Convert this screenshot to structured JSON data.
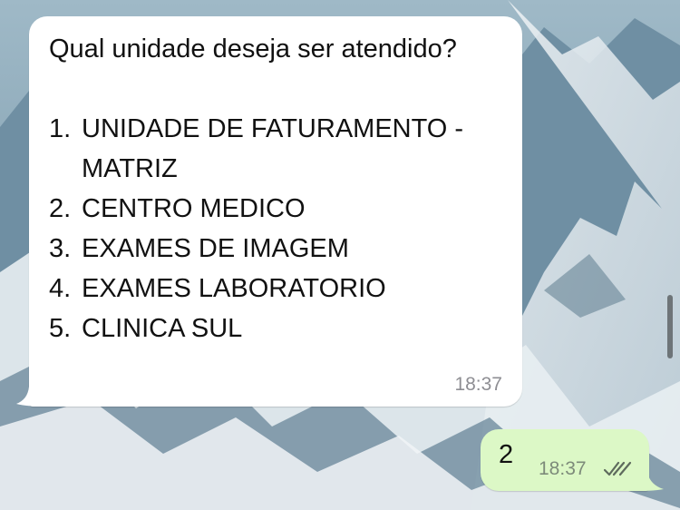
{
  "incoming_message": {
    "question": "Qual unidade deseja ser atendido?",
    "options": [
      {
        "number": "1.",
        "label": "UNIDADE DE FATURAMENTO - MATRIZ"
      },
      {
        "number": "2.",
        "label": "CENTRO MEDICO"
      },
      {
        "number": "3.",
        "label": "EXAMES DE IMAGEM"
      },
      {
        "number": "4.",
        "label": "EXAMES LABORATORIO"
      },
      {
        "number": "5.",
        "label": "CLINICA SUL"
      }
    ],
    "time": "18:37"
  },
  "outgoing_message": {
    "text": "2",
    "time": "18:37",
    "status_icon": "double-check-icon"
  },
  "colors": {
    "incoming_bubble": "#ffffff",
    "outgoing_bubble": "#dcf8c6",
    "timestamp_gray": "#8e8e93"
  }
}
